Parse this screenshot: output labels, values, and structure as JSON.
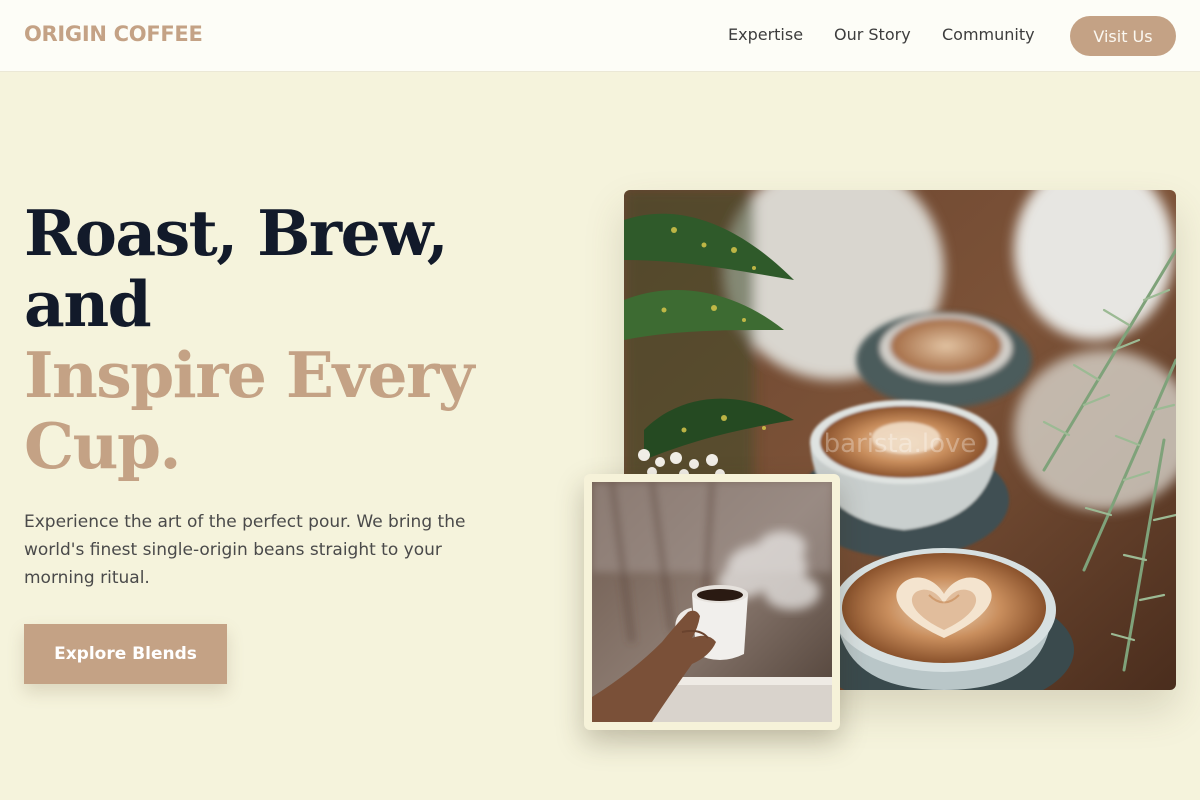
{
  "brand": {
    "logo": "ORIGIN COFFEE",
    "accent_color": "#c4a285",
    "background_color": "#f5f3dc"
  },
  "nav": {
    "links": [
      "Expertise",
      "Our Story",
      "Community"
    ],
    "cta": "Visit Us"
  },
  "hero": {
    "title_lines": [
      "Roast, Brew,",
      "and"
    ],
    "accent_lines": [
      "Inspire Every",
      "Cup."
    ],
    "description": "Experience the art of the perfect pour. We bring the world's finest single-origin beans straight to your morning ritual.",
    "cta": "Explore Blends"
  },
  "images": {
    "main_watermark": "barista.love"
  }
}
